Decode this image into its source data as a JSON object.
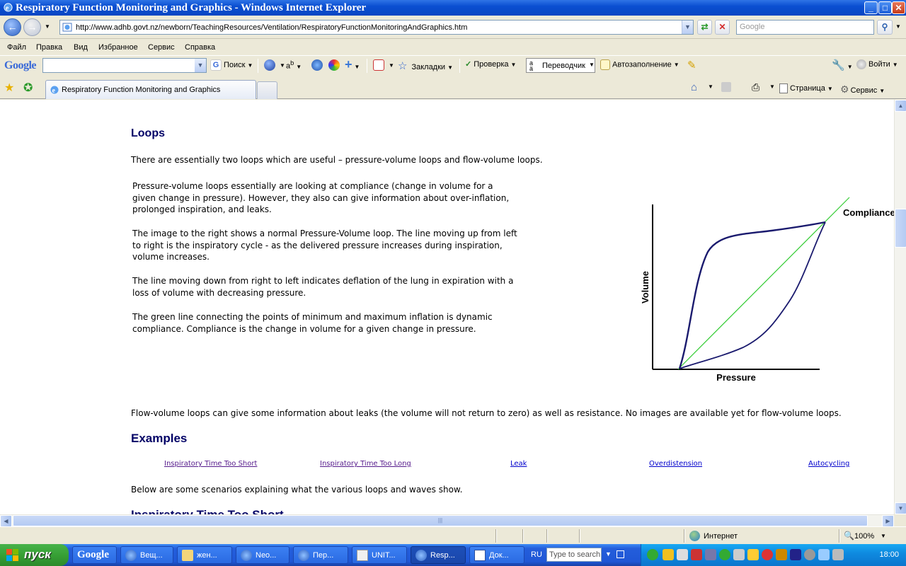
{
  "window": {
    "title": "Respiratory Function Monitoring and Graphics - Windows Internet Explorer",
    "minimize": "_",
    "maximize": "□",
    "close": "✕"
  },
  "address": {
    "url": "http://www.adhb.govt.nz/newborn/TeachingResources/Ventilation/RespiratoryFunctionMonitoringAndGraphics.htm",
    "search_placeholder": "Google"
  },
  "menu": [
    "Файл",
    "Правка",
    "Вид",
    "Избранное",
    "Сервис",
    "Справка"
  ],
  "google_toolbar": {
    "logo": "Google",
    "search_label": "Поиск",
    "bookmarks_label": "Закладки",
    "check_label": "Проверка",
    "translator_label": "Переводчик",
    "autofill_label": "Автозаполнение",
    "signin_label": "Войти"
  },
  "tabs": {
    "active_label": "Respiratory Function Monitoring and Graphics",
    "page_label": "Страница",
    "tools_label": "Сервис"
  },
  "content": {
    "heading_loops": "Loops",
    "intro": "There are essentially two loops which are useful – pressure-volume loops and flow-volume loops.",
    "p1": "Pressure-volume loops essentially are looking at compliance (change in volume for a given change in pressure). However, they also can give information about over-inflation, prolonged inspiration, and leaks.",
    "p2": "The image to the right shows a normal Pressure-Volume loop.  The line moving up from left to right is the inspiratory cycle - as the delivered pressure increases during inspiration, volume increases.",
    "p3": "The line moving down from right to left indicates deflation of the lung in expiration with a loss of volume with decreasing pressure.",
    "p4": "The green line connecting the points of minimum and maximum inflation is dynamic compliance.  Compliance is the change in volume for a given change in pressure.",
    "p5": "Flow-volume loops can give some information about leaks (the volume will not return to zero) as well as resistance.  No images are available yet for flow-volume loops.",
    "heading_examples": "Examples",
    "links": [
      "Inspiratory Time Too Short",
      "Inspiratory Time Too Long",
      "Leak",
      "Overdistension",
      "Autocycling"
    ],
    "scenarios": "Below are some scenarios explaining what the various loops and waves show.",
    "next_heading": "Inspiratory Time Too Short"
  },
  "figure": {
    "y_label": "Volume",
    "x_label": "Pressure",
    "line_label": "Compliance",
    "loop_color": "#1a1a6e",
    "compliance_color": "#33cc33"
  },
  "status": {
    "zone": "Интернет",
    "zoom": "100%"
  },
  "taskbar": {
    "start": "пуск",
    "buttons": [
      "Google",
      "Вещ...",
      "жен...",
      "Neo...",
      "Пер...",
      "UNIT...",
      "Resp...",
      "Док..."
    ],
    "lang": "RU",
    "search_placeholder": "Type to search",
    "clock": "18:00"
  }
}
